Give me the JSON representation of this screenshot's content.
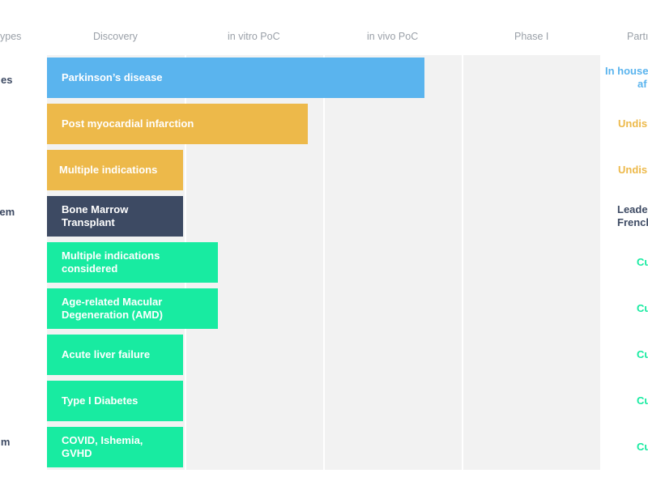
{
  "colors": {
    "blue": "#5ab4ee",
    "yellow": "#edb94a",
    "navy": "#3d4a63",
    "green": "#18eba1",
    "header_text": "#9aa0a8",
    "band": "#f2f2f2"
  },
  "headers": [
    "ypes",
    "Discovery",
    "in vitro PoC",
    "in vivo PoC",
    "Phase I",
    "Partı"
  ],
  "left_labels": [
    "es",
    "em",
    "m"
  ],
  "chart_data": {
    "type": "bar",
    "orientation": "horizontal",
    "stages": [
      "Discovery",
      "in vitro PoC",
      "in vivo PoC",
      "Phase I"
    ],
    "rows": [
      {
        "label": "Parkinson’s disease",
        "progress": 2.75,
        "color": "#5ab4ee",
        "partner": "In house\naf"
      },
      {
        "label": "Post myocardial infarction",
        "progress": 1.9,
        "color": "#edb94a",
        "partner": "Undis"
      },
      {
        "label": "Multiple indications",
        "progress": 1.0,
        "color": "#edb94a",
        "partner": "Undis"
      },
      {
        "label": "Bone Marrow\nTransplant",
        "progress": 1.0,
        "color": "#3d4a63",
        "partner": "Leade\nFrench"
      },
      {
        "label": "Multiple indications\nconsidered",
        "progress": 1.25,
        "color": "#18eba1",
        "partner": "Cu"
      },
      {
        "label": "Age-related Macular\nDegeneration (AMD)",
        "progress": 1.25,
        "color": "#18eba1",
        "partner": "Cu"
      },
      {
        "label": "Acute liver failure",
        "progress": 1.0,
        "color": "#18eba1",
        "partner": "Cu"
      },
      {
        "label": "Type I Diabetes",
        "progress": 1.0,
        "color": "#18eba1",
        "partner": "Cu"
      },
      {
        "label": "COVID, Ishemia,\nGVHD",
        "progress": 1.0,
        "color": "#18eba1",
        "partner": "Cu"
      }
    ]
  }
}
